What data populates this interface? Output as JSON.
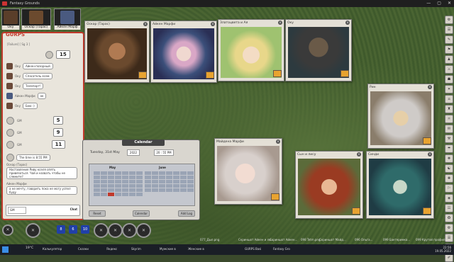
{
  "window": {
    "title": "Fantasy Grounds",
    "controls": [
      "—",
      "▢",
      "✕"
    ]
  },
  "party": [
    {
      "name": "Оку"
    },
    {
      "name": "Оскар (Тарас)"
    },
    {
      "name": "Айкен Марф"
    }
  ],
  "chat": {
    "header": "GURPS",
    "subheader": "[Failure] [ Sg 3 ]",
    "messages": [
      {
        "nick": "Оку",
        "text": "Айкен-позорный"
      },
      {
        "nick": "Оку",
        "text": "Спасатель есем"
      },
      {
        "nick": "Оку",
        "text": "Телепорт!"
      },
      {
        "nick": "Айкен Марфи",
        "text": "ок"
      },
      {
        "nick": "Оку",
        "text": "Бою :)"
      },
      {
        "nick": "Оскар (Тарас)",
        "text": "Наставление Риву кселя опять привязаться. Чай и назвать чтобы не слемите?"
      },
      {
        "nick": "Айкен Марфи",
        "text": "а не мечту, говорить пока не могу успел буду"
      }
    ],
    "rolls": [
      {
        "who": "",
        "value": "15"
      },
      {
        "who": "GM",
        "value": "5"
      },
      {
        "who": "GM",
        "value": "9"
      },
      {
        "who": "GM",
        "value": "11"
      }
    ],
    "time_note": "The time is 8:55 PM",
    "input": {
      "target": "GM",
      "format": "Chat"
    }
  },
  "portraits": [
    {
      "title": "Оскар (Тарас)",
      "colors": [
        "#6b4a2e",
        "#3d2a1a"
      ]
    },
    {
      "title": "Айкен Марфи",
      "colors": [
        "#3b4f7a",
        "#d9a7c6"
      ]
    },
    {
      "title": "Златоцвета и Ая",
      "colors": [
        "#9fc270",
        "#e8d78a"
      ]
    },
    {
      "title": "Оку",
      "colors": [
        "#2d3a3f",
        "#6a5a48"
      ]
    },
    {
      "title": "Рин",
      "colors": [
        "#cfcbc8",
        "#8a7d6b"
      ]
    },
    {
      "title": "Майдена Марфи",
      "colors": [
        "#d8d0cc",
        "#a89a90"
      ]
    },
    {
      "title": "Сын и лису",
      "colors": [
        "#9a3b22",
        "#5b6b3a"
      ]
    },
    {
      "title": "Синди",
      "colors": [
        "#2f6b6a",
        "#1f3c44"
      ]
    }
  ],
  "calendar": {
    "title": "Calendar",
    "date": "Tuesday, 31st May",
    "year": "2022",
    "time": "20 : 55 PM",
    "month_a": "May",
    "month_b": "June",
    "buttons": [
      "Reset",
      "Calendar",
      "Add Log"
    ]
  },
  "hotbar": [
    "✕",
    "✕",
    "✕",
    "✕",
    "✕",
    "✕",
    "✕",
    "✕"
  ],
  "hotbar_numbers": [
    "8",
    "6",
    "10"
  ],
  "taskbar": {
    "weather": "19°С",
    "items": [
      "Калькулятор",
      "Сказки",
      "Яндекс",
      "Skyrim",
      "Мужские в",
      "Женские в",
      "GURPS Basi",
      "Fantasy Gro"
    ],
    "clock_time": "22:56",
    "clock_date": "19.05.2022"
  },
  "files": [
    "077_Дыл.png",
    "Скриншот Айкен и ли...",
    "Скриншот Айкен...",
    "098 Tetm.png",
    "Скриншот Майд...",
    "096 Ольга...",
    "099 Бактеримка...",
    "099 Крутой профиль..."
  ]
}
